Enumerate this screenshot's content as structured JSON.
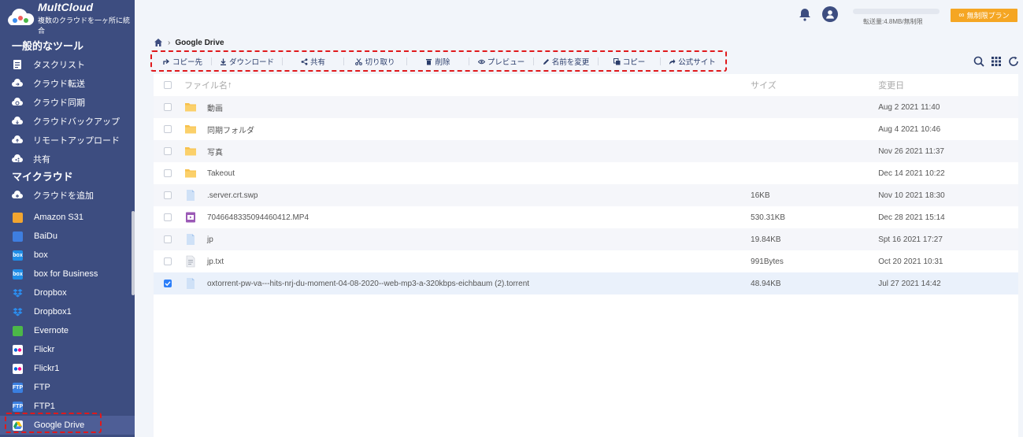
{
  "brand": {
    "name": "MultCloud",
    "tagline": "複数のクラウドを一ヶ所に統合"
  },
  "sidebar": {
    "tools_title": "一般的なツール",
    "tools": [
      {
        "label": "タスクリスト",
        "icon": "task-list-icon"
      },
      {
        "label": "クラウド転送",
        "icon": "cloud-transfer-icon"
      },
      {
        "label": "クラウド同期",
        "icon": "cloud-sync-icon"
      },
      {
        "label": "クラウドバックアップ",
        "icon": "cloud-backup-icon"
      },
      {
        "label": "リモートアップロード",
        "icon": "remote-upload-icon"
      },
      {
        "label": "共有",
        "icon": "share-icon"
      }
    ],
    "my_cloud_title": "マイクラウド",
    "add_cloud": "クラウドを追加",
    "clouds": [
      {
        "label": "Amazon S31",
        "icon": "amazon-s3-icon",
        "color": "#f2a530"
      },
      {
        "label": "BaiDu",
        "icon": "baidu-icon",
        "color": "#3e7ee0"
      },
      {
        "label": "box",
        "icon": "box-icon",
        "color": "#1f8ee8"
      },
      {
        "label": "box for Business",
        "icon": "box-business-icon",
        "color": "#1f8ee8"
      },
      {
        "label": "Dropbox",
        "icon": "dropbox-icon",
        "color": "#2b8ef0"
      },
      {
        "label": "Dropbox1",
        "icon": "dropbox-icon",
        "color": "#2b8ef0"
      },
      {
        "label": "Evernote",
        "icon": "evernote-icon",
        "color": "#4cb848"
      },
      {
        "label": "Flickr",
        "icon": "flickr-icon",
        "color": "#ffffff"
      },
      {
        "label": "Flickr1",
        "icon": "flickr-icon",
        "color": "#ffffff"
      },
      {
        "label": "FTP",
        "icon": "ftp-icon",
        "color": "#3a7fe0"
      },
      {
        "label": "FTP1",
        "icon": "ftp-icon",
        "color": "#3a7fe0"
      },
      {
        "label": "Google Drive",
        "icon": "google-drive-icon",
        "color": "#ffffff"
      }
    ]
  },
  "topbar": {
    "usage_text": "転送量:4.8MB/無制限",
    "upgrade_label": "無制限プラン",
    "usage_fraction": 0.002
  },
  "breadcrumb": {
    "current": "Google Drive"
  },
  "toolbar": {
    "buttons": [
      {
        "label": "コピー先",
        "icon": "copy-to-icon"
      },
      {
        "label": "ダウンロード",
        "icon": "download-icon"
      },
      {
        "label": "共有",
        "icon": "share-icon"
      },
      {
        "label": "切り取り",
        "icon": "cut-icon"
      },
      {
        "label": "削除",
        "icon": "delete-icon"
      },
      {
        "label": "プレビュー",
        "icon": "preview-icon"
      },
      {
        "label": "名前を変更",
        "icon": "rename-icon"
      },
      {
        "label": "コピー",
        "icon": "copy-icon"
      },
      {
        "label": "公式サイト",
        "icon": "official-site-icon"
      }
    ]
  },
  "table": {
    "headers": {
      "name": "ファイル名",
      "size": "サイズ",
      "date": "変更日"
    },
    "rows": [
      {
        "name": "動画",
        "size": "",
        "date": "Aug 2 2021 11:40",
        "type": "folder",
        "checked": false
      },
      {
        "name": "同期フォルダ",
        "size": "",
        "date": "Aug 4 2021 10:46",
        "type": "folder",
        "checked": false
      },
      {
        "name": "写真",
        "size": "",
        "date": "Nov 26 2021 11:37",
        "type": "folder",
        "checked": false
      },
      {
        "name": "Takeout",
        "size": "",
        "date": "Dec 14 2021 10:22",
        "type": "folder",
        "checked": false
      },
      {
        "name": ".server.crt.swp",
        "size": "16KB",
        "date": "Nov 10 2021 18:30",
        "type": "file",
        "checked": false
      },
      {
        "name": "7046648335094460412.MP4",
        "size": "530.31KB",
        "date": "Dec 28 2021 15:14",
        "type": "video",
        "checked": false
      },
      {
        "name": "jp",
        "size": "19.84KB",
        "date": "Spt 16 2021 17:27",
        "type": "file",
        "checked": false
      },
      {
        "name": "jp.txt",
        "size": "991Bytes",
        "date": "Oct 20 2021 10:31",
        "type": "text",
        "checked": false
      },
      {
        "name": "oxtorrent-pw-va---hits-nrj-du-moment-04-08-2020--web-mp3-a-320kbps-eichbaum (2).torrent",
        "size": "48.94KB",
        "date": "Jul 27 2021 14:42",
        "type": "file",
        "checked": true
      }
    ]
  }
}
